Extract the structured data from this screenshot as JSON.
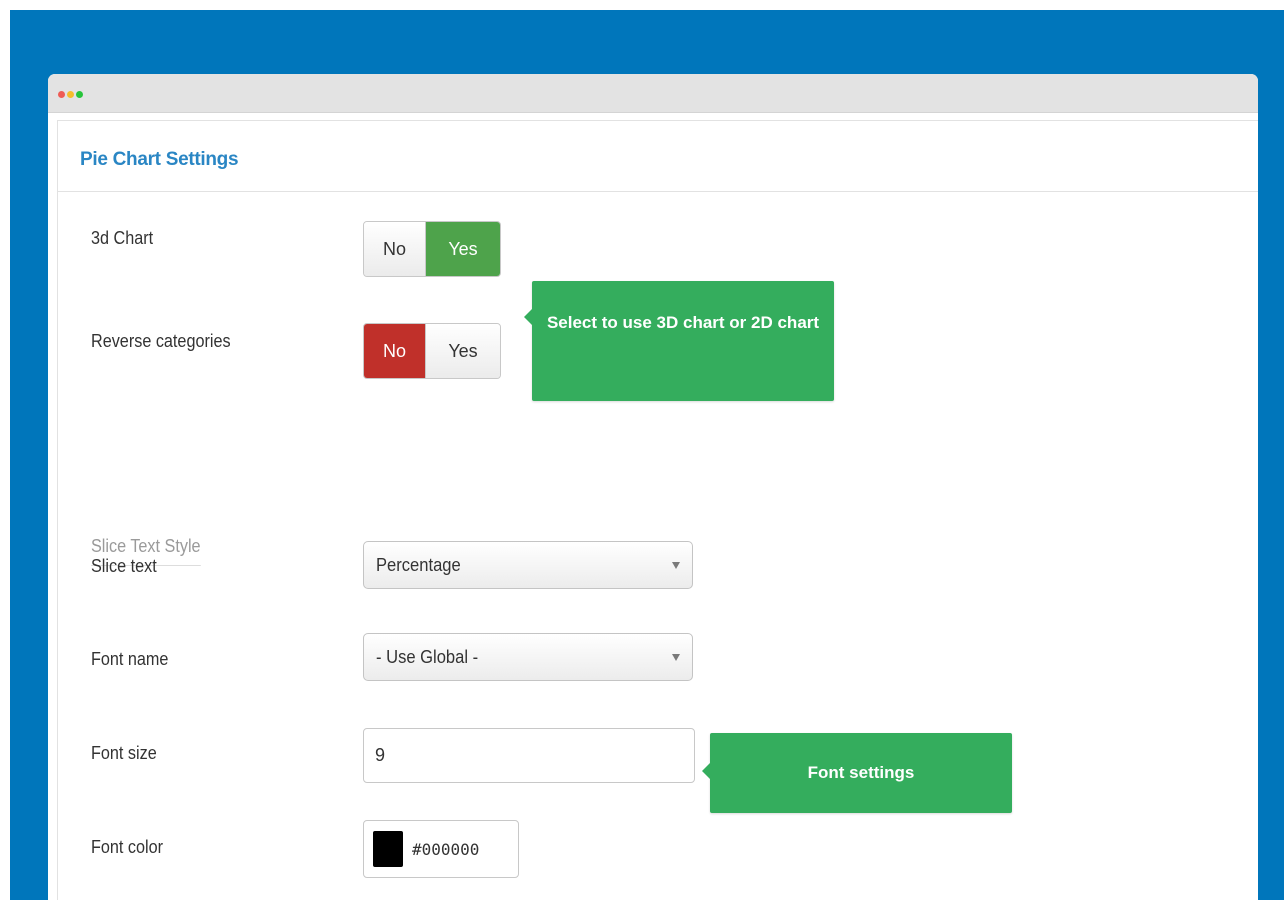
{
  "panel": {
    "title": "Pie Chart Settings"
  },
  "fields": {
    "chart3d": {
      "label": "3d Chart",
      "no": "No",
      "yes": "Yes",
      "selected": "Yes"
    },
    "reverse_categories": {
      "label": "Reverse categories",
      "no": "No",
      "yes": "Yes",
      "selected": "No"
    },
    "section_title": "Slice Text Style",
    "slice_text": {
      "label": "Slice text",
      "value": "Percentage"
    },
    "font_name": {
      "label": "Font name",
      "value": "- Use Global -"
    },
    "font_size": {
      "label": "Font size",
      "value": "9"
    },
    "font_color": {
      "label": "Font color",
      "value": "#000000"
    }
  },
  "tooltips": {
    "chart3d": "Select to use 3D chart or 2D chart",
    "font": "Font settings"
  },
  "colors": {
    "background": "#0076bb",
    "title": "#2a86c4",
    "toggle_yes_active": "#4ea34b",
    "toggle_no_active": "#c0302a",
    "tooltip": "#34ad5d"
  },
  "icons": {
    "window_controls": [
      "close-dot",
      "minimize-dot",
      "maximize-dot"
    ],
    "select_arrow": "caret-down-icon"
  }
}
